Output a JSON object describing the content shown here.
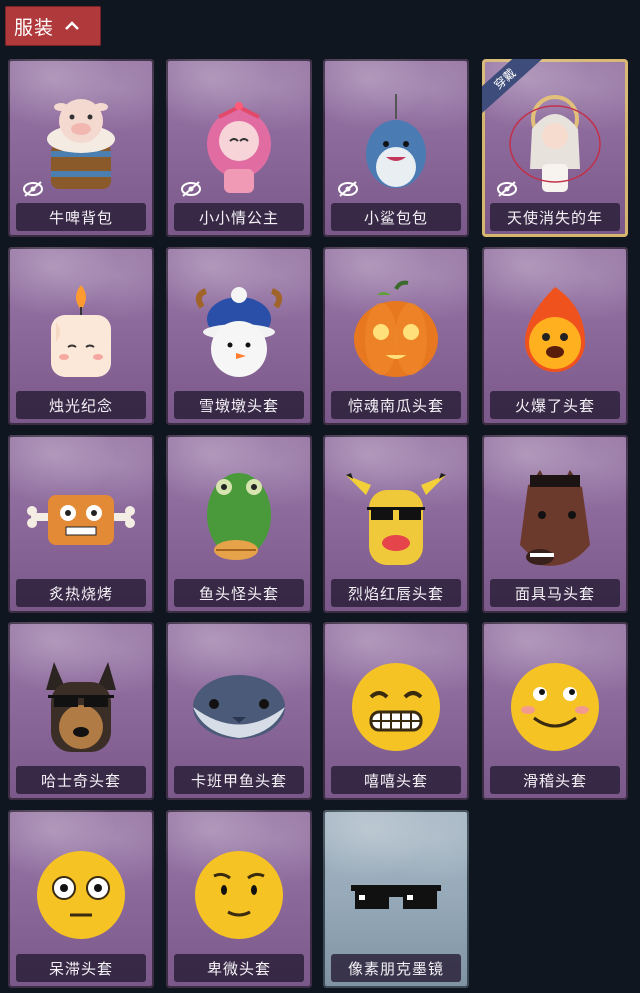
{
  "tab": {
    "label": "服装"
  },
  "items": [
    {
      "name": "牛啤背包",
      "hidden": true,
      "art": "cow-beer-backpack"
    },
    {
      "name": "小小情公主",
      "hidden": true,
      "art": "pink-princess"
    },
    {
      "name": "小鲨包包",
      "hidden": true,
      "art": "shark-bag"
    },
    {
      "name": "天使消失的年",
      "hidden": true,
      "worn": true,
      "worn_label": "穿戴",
      "art": "angel-figure"
    },
    {
      "name": "烛光纪念",
      "art": "candle-head"
    },
    {
      "name": "雪墩墩头套",
      "art": "snowman-head"
    },
    {
      "name": "惊魂南瓜头套",
      "art": "pumpkin-head"
    },
    {
      "name": "火爆了头套",
      "art": "fire-head"
    },
    {
      "name": "炙热烧烤",
      "art": "bbq-head"
    },
    {
      "name": "鱼头怪头套",
      "art": "fish-head"
    },
    {
      "name": "烈焰红唇头套",
      "art": "yellow-mask-head"
    },
    {
      "name": "面具马头套",
      "art": "horse-head"
    },
    {
      "name": "哈士奇头套",
      "art": "husky-head"
    },
    {
      "name": "卡班甲鱼头套",
      "art": "fish-blob-head"
    },
    {
      "name": "嘻嘻头套",
      "art": "grin-emoji-head"
    },
    {
      "name": "滑稽头套",
      "art": "smirk-emoji-head"
    },
    {
      "name": "呆滞头套",
      "art": "dazed-emoji-head"
    },
    {
      "name": "卑微头套",
      "art": "humble-emoji-head"
    },
    {
      "name": "像素朋克墨镜",
      "ghost": true,
      "art": "pixel-sunglasses"
    }
  ]
}
